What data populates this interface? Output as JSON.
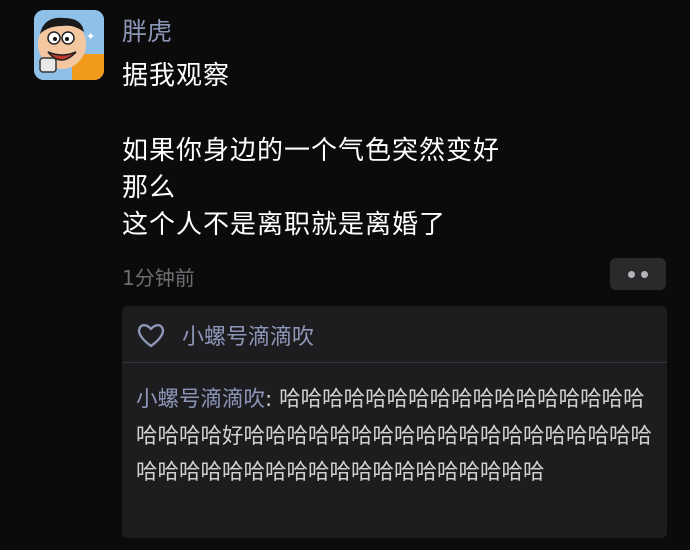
{
  "post": {
    "author": "胖虎",
    "lines": [
      "据我观察",
      "",
      "如果你身边的一个气色突然变好",
      "那么",
      "这个人不是离职就是离婚了"
    ],
    "time": "1分钟前"
  },
  "likes": {
    "names": "小螺号滴滴吹"
  },
  "comment": {
    "author": "小螺号滴滴吹",
    "separator": ": ",
    "text": "哈哈哈哈哈哈哈哈哈哈哈哈哈哈哈哈哈哈哈哈哈好哈哈哈哈哈哈哈哈哈哈哈哈哈哈哈哈哈哈哈哈哈哈哈哈哈哈哈哈哈哈哈哈哈哈哈哈哈哈"
  },
  "colors": {
    "background": "#0b0b0b",
    "name_accent": "#8e96b8",
    "panel": "#1d1d20"
  },
  "icons": {
    "avatar": "cartoon-avatar",
    "like": "heart-outline-icon",
    "more": "more-dots-icon"
  }
}
